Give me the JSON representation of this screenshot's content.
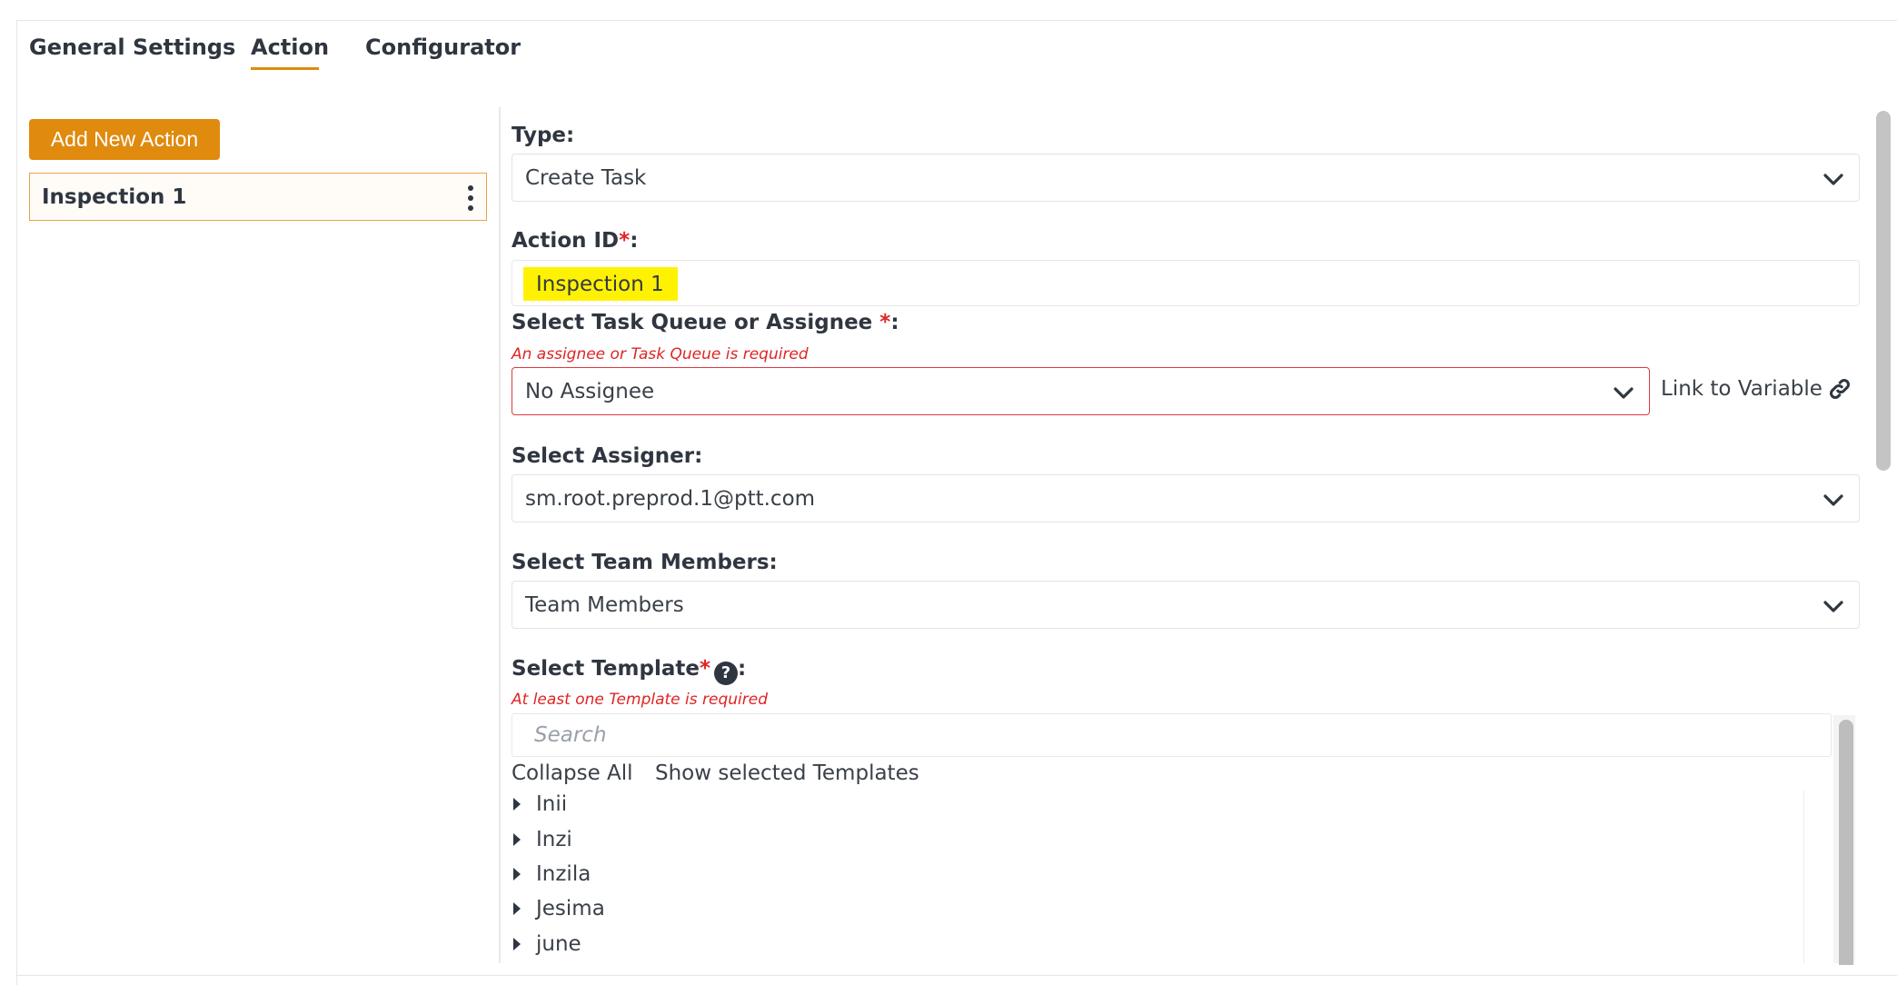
{
  "tabs": [
    {
      "label": "General Settings"
    },
    {
      "label": "Action",
      "active": true
    },
    {
      "label": "Configurator"
    }
  ],
  "sidebar": {
    "add_button_label": "Add New Action",
    "actions": [
      {
        "label": "Inspection 1",
        "selected": true
      }
    ]
  },
  "form": {
    "type": {
      "label": "Type:",
      "value": "Create Task"
    },
    "action_id": {
      "label": "Action ID",
      "required_mark": "*",
      "colon": ":",
      "value": "Inspection 1"
    },
    "task_queue": {
      "label": "Select Task Queue or Assignee ",
      "required_mark": "*",
      "colon": ":",
      "error": "An assignee or Task Queue is required",
      "value": "No Assignee",
      "link_label": "Link to Variable"
    },
    "assigner": {
      "label": "Select Assigner:",
      "value": "sm.root.preprod.1@ptt.com"
    },
    "team_members": {
      "label": "Select Team Members:",
      "value": "Team Members"
    },
    "template": {
      "label": "Select Template",
      "required_mark": "*",
      "help_glyph": "?",
      "colon": ":",
      "error": "At least one Template is required",
      "search_placeholder": "Search",
      "collapse_all": "Collapse All",
      "show_selected": "Show selected Templates",
      "items": [
        "Inii",
        "Inzi",
        "Inzila",
        "Jesima",
        "june"
      ]
    }
  },
  "colors": {
    "accent": "#e08a0e",
    "error": "#e02424",
    "highlight": "#fff200"
  },
  "icons": {
    "chevron": "chevron-down-icon",
    "link": "link-icon",
    "help": "help-icon",
    "kebab": "more-vertical-icon",
    "caret": "caret-right-icon"
  }
}
